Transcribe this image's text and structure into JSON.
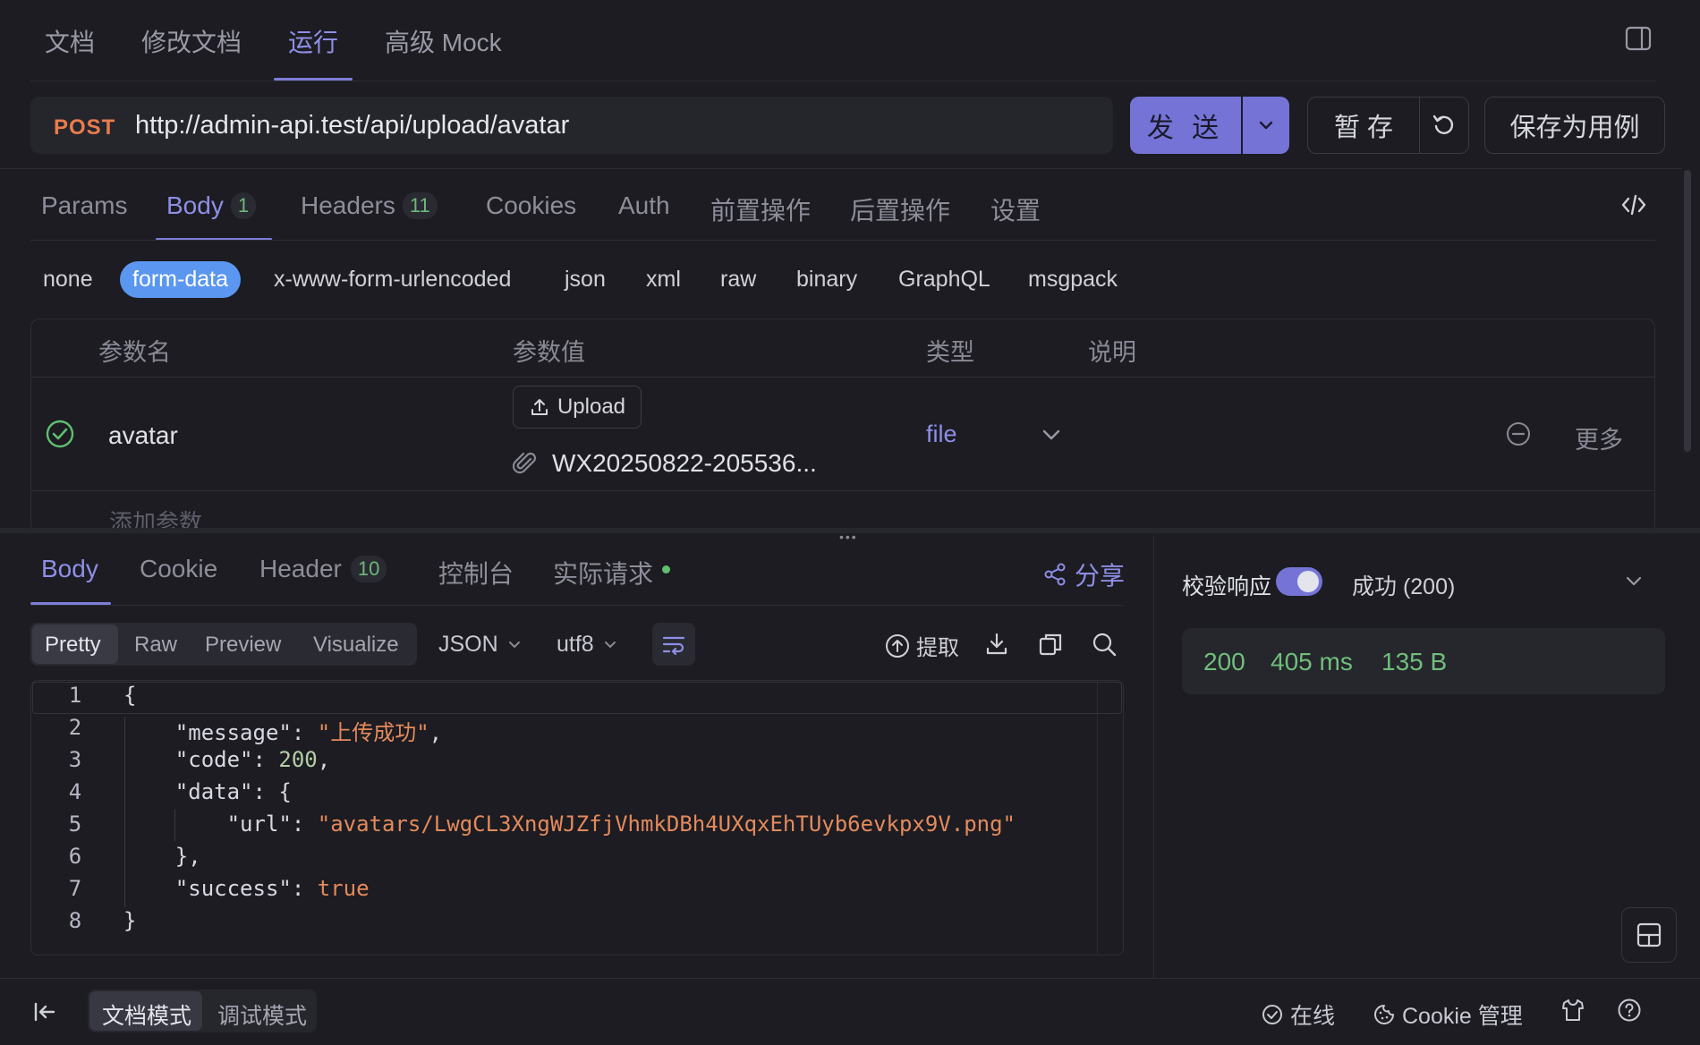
{
  "top_tabs": [
    {
      "label": "文档"
    },
    {
      "label": "修改文档"
    },
    {
      "label": "运行",
      "active": true
    },
    {
      "label": "高级 Mock"
    }
  ],
  "request": {
    "method": "POST",
    "url": "http://admin-api.test/api/upload/avatar"
  },
  "actions": {
    "send": "发 送",
    "stash": "暂 存",
    "save_case": "保存为用例"
  },
  "request_tabs": [
    {
      "label": "Params"
    },
    {
      "label": "Body",
      "count": "1",
      "active": true
    },
    {
      "label": "Headers",
      "count": "11"
    },
    {
      "label": "Cookies"
    },
    {
      "label": "Auth"
    },
    {
      "label": "前置操作"
    },
    {
      "label": "后置操作"
    },
    {
      "label": "设置"
    }
  ],
  "body_types": [
    "none",
    "form-data",
    "x-www-form-urlencoded",
    "json",
    "xml",
    "raw",
    "binary",
    "GraphQL",
    "msgpack"
  ],
  "body_type_selected": "form-data",
  "params_table": {
    "headers": {
      "name": "参数名",
      "value": "参数值",
      "type": "类型",
      "desc": "说明"
    },
    "rows": [
      {
        "name": "avatar",
        "upload_label": "Upload",
        "file_name": "WX20250822-205536...",
        "type": "file",
        "more": "更多"
      }
    ],
    "add_placeholder": "添加参数"
  },
  "response_tabs": [
    {
      "label": "Body",
      "active": true
    },
    {
      "label": "Cookie"
    },
    {
      "label": "Header",
      "count": "10"
    },
    {
      "label": "控制台"
    },
    {
      "label": "实际请求",
      "dot_color": "#5fbf6f"
    }
  ],
  "share_label": "分享",
  "view_modes": [
    "Pretty",
    "Raw",
    "Preview",
    "Visualize"
  ],
  "view_mode_selected": "Pretty",
  "format": "JSON",
  "encoding": "utf8",
  "extract_label": "提取",
  "code_lines": [
    {
      "n": "1"
    },
    {
      "n": "2"
    },
    {
      "n": "3"
    },
    {
      "n": "4"
    },
    {
      "n": "5"
    },
    {
      "n": "6"
    },
    {
      "n": "7"
    },
    {
      "n": "8"
    }
  ],
  "response_json": {
    "message_key": "\"message\"",
    "message_val": "\"上传成功\"",
    "code_key": "\"code\"",
    "code_val": "200",
    "data_key": "\"data\"",
    "url_key": "\"url\"",
    "url_val": "\"avatars/LwgCL3XngWJZfjVhmkDBh4UXqxEhTUyb6evkpx9V.png\"",
    "success_key": "\"success\"",
    "success_val": "true"
  },
  "validation": {
    "label": "校验响应",
    "enabled": true,
    "result": "成功 (200)"
  },
  "status": {
    "code": "200",
    "time": "405 ms",
    "size": "135 B",
    "color": "#6fbf7a"
  },
  "footer": {
    "modes": [
      "文档模式",
      "调试模式"
    ],
    "mode_selected": "文档模式",
    "online": "在线",
    "cookie_manage": "Cookie 管理"
  },
  "colors": {
    "accent": "#7574d6",
    "background": "#1c1c22",
    "method": "#e97c4d",
    "string": "#e48a5c",
    "success": "#6fbf7a"
  }
}
